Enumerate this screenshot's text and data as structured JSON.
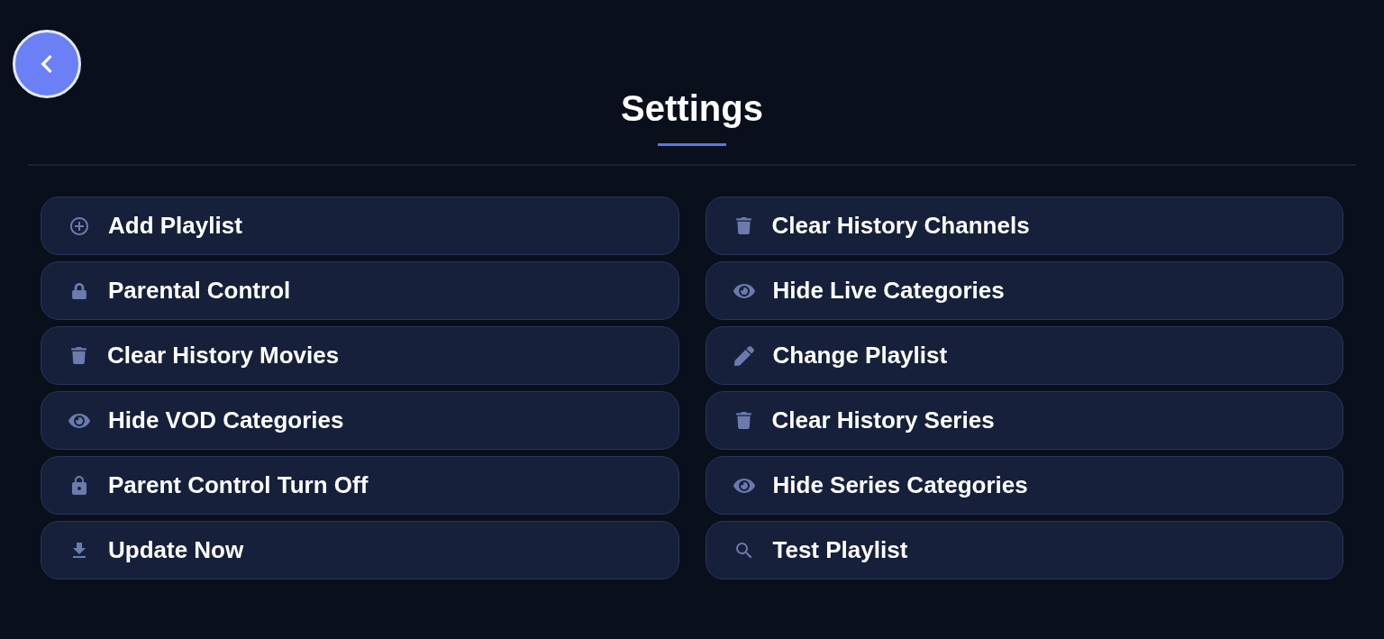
{
  "header": {
    "title": "Settings"
  },
  "options": [
    {
      "label": "Add Playlist",
      "kind": "add"
    },
    {
      "label": "Clear History Channels",
      "kind": "trash"
    },
    {
      "label": "Parental Control",
      "kind": "lock"
    },
    {
      "label": "Hide Live Categories",
      "kind": "eye"
    },
    {
      "label": "Clear History Movies",
      "kind": "trash"
    },
    {
      "label": "Change Playlist",
      "kind": "edit"
    },
    {
      "label": "Hide VOD Categories",
      "kind": "eye"
    },
    {
      "label": "Clear History Series",
      "kind": "trash"
    },
    {
      "label": "Parent Control Turn Off",
      "kind": "keylock"
    },
    {
      "label": "Hide Series Categories",
      "kind": "eye"
    },
    {
      "label": "Update Now",
      "kind": "download"
    },
    {
      "label": "Test Playlist",
      "kind": "search"
    }
  ]
}
